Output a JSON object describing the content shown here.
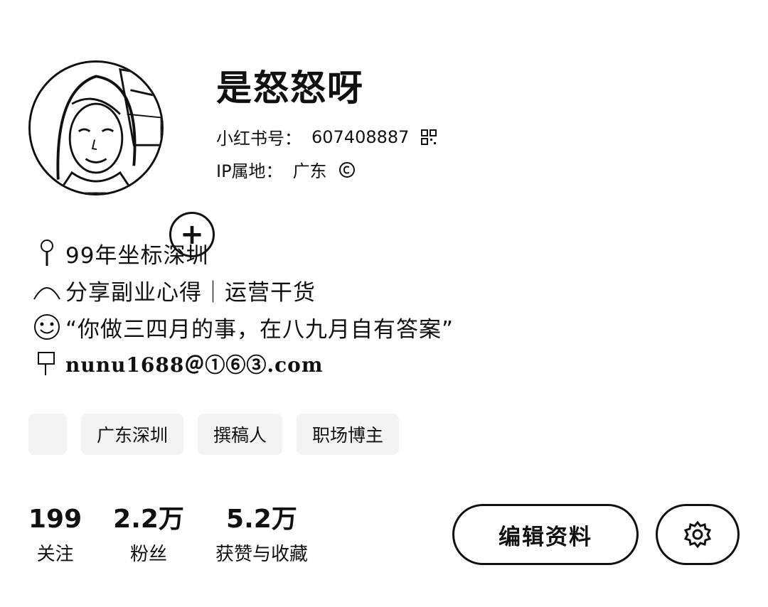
{
  "profile": {
    "username": "是怒怒呀",
    "id_label": "小红书号：",
    "id_value": "607408887",
    "ip_label": "IP属地：",
    "ip_value": "广东",
    "add_symbol": "+"
  },
  "bio": {
    "lines": [
      {
        "icon": "pin-emoji-icon",
        "text": "99年坐标深圳"
      },
      {
        "icon": "rainbow-emoji-icon",
        "text": "分享副业心得｜运营干货"
      },
      {
        "icon": "smile-emoji-icon",
        "text": "“你做三四月的事，在八九月自有答案”"
      },
      {
        "icon": "mailbox-emoji-icon",
        "text": "nunu1688＠①⑥③.com"
      }
    ]
  },
  "tags": [
    "",
    "广东深圳",
    "撰稿人",
    "职场博主"
  ],
  "stats": [
    {
      "value": "199",
      "label": "关注"
    },
    {
      "value": "2.2万",
      "label": "粉丝"
    },
    {
      "value": "5.2万",
      "label": "获赞与收藏"
    }
  ],
  "actions": {
    "edit_label": "编辑资料",
    "settings_icon": "gear-icon"
  }
}
